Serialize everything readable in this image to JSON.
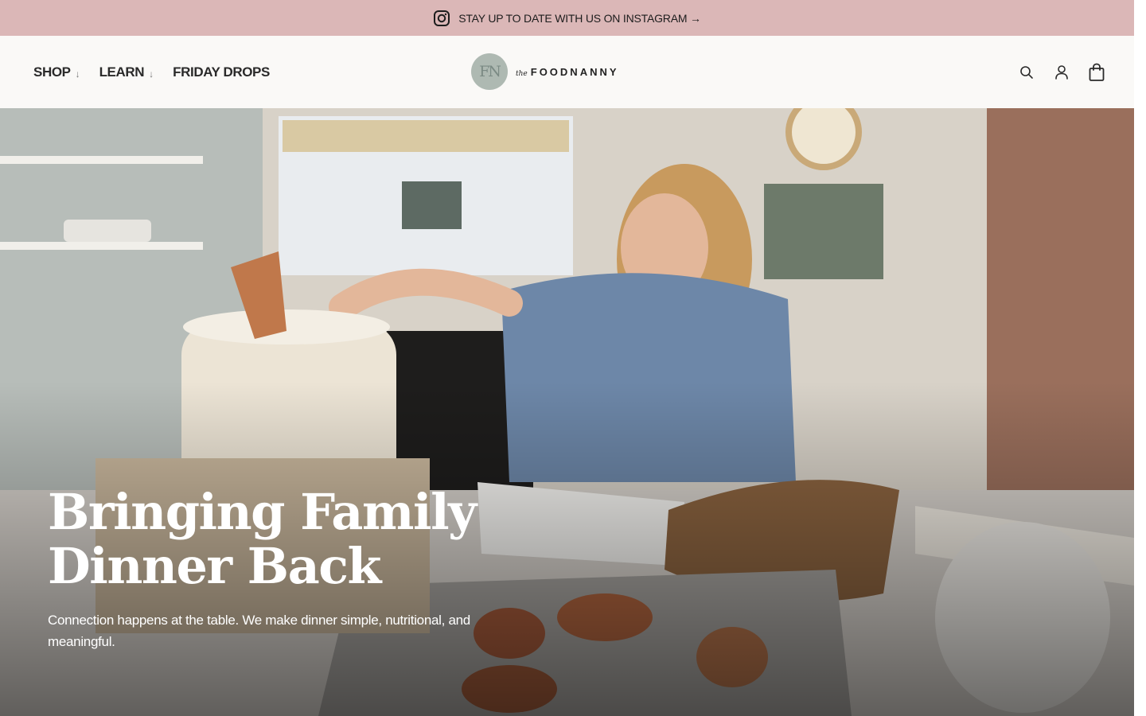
{
  "promo": {
    "text": "STAY UP TO DATE WITH US ON INSTAGRAM →",
    "icon": "instagram-icon",
    "background": "#dbb7b7"
  },
  "header": {
    "nav": [
      {
        "label": "SHOP",
        "has_dropdown": true
      },
      {
        "label": "LEARN",
        "has_dropdown": true
      },
      {
        "label": "FRIDAY DROPS",
        "has_dropdown": false
      }
    ],
    "dropdown_glyph": "↓",
    "logo": {
      "mark": "FN",
      "prefix": "the",
      "name": "FOODNANNY"
    },
    "utility_icons": [
      "search-icon",
      "account-icon",
      "cart-icon"
    ]
  },
  "hero": {
    "title": "Bringing Family Dinner Back",
    "subtitle": "Connection happens at the table. We make dinner simple, nutritional, and meaningful.",
    "image_alt_icon": "kitchen-photo"
  }
}
